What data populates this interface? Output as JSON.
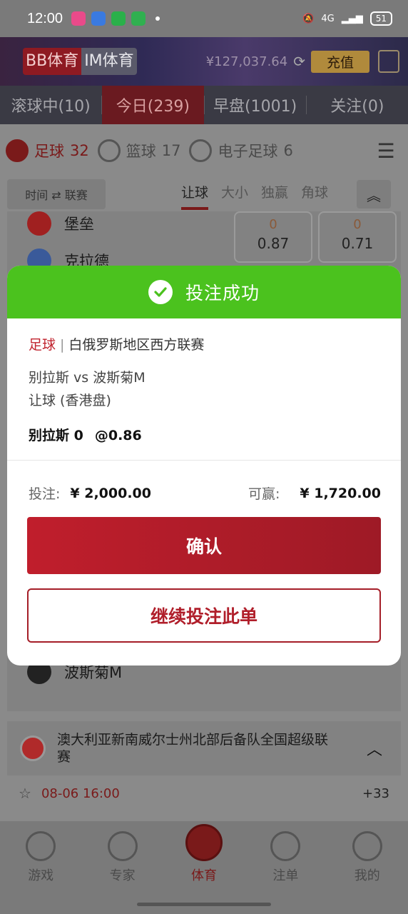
{
  "status_bar": {
    "time": "12:00",
    "battery": "51",
    "network": "4G"
  },
  "header": {
    "brand_bb": "BB体育",
    "brand_im": "IM体育",
    "balance": "¥127,037.64",
    "recharge": "充值"
  },
  "tabs": [
    {
      "label": "滚球中(10)"
    },
    {
      "label": "今日(239)"
    },
    {
      "label": "早盘(1001)"
    },
    {
      "label": "关注(0)"
    }
  ],
  "sports": [
    {
      "name": "足球",
      "count": "32"
    },
    {
      "name": "篮球",
      "count": "17"
    },
    {
      "name": "电子足球",
      "count": "6"
    }
  ],
  "market": {
    "sort_label": "时间 ⇄ 联赛",
    "tabs": [
      "让球",
      "大小",
      "独赢",
      "角球"
    ]
  },
  "match_bg": {
    "team1": "堡垒",
    "team2": "克拉德",
    "team3": "波斯菊M",
    "odds": [
      {
        "line": "0",
        "price": "0.87"
      },
      {
        "line": "0",
        "price": "0.71"
      }
    ]
  },
  "league_row": {
    "name": "澳大利亚新南威尔士州北部后备队全国超级联赛",
    "date": "08-06 16:00",
    "more": "+33"
  },
  "bottom_nav": [
    {
      "label": "游戏"
    },
    {
      "label": "专家"
    },
    {
      "label": "体育"
    },
    {
      "label": "注单"
    },
    {
      "label": "我的"
    }
  ],
  "modal": {
    "title": "投注成功",
    "sport": "足球",
    "league": "白俄罗斯地区西方联赛",
    "match": "别拉斯 vs 波斯菊M",
    "market": "让球 (香港盘)",
    "pick": "别拉斯 0",
    "odds": "@0.86",
    "stake_label": "投注:",
    "stake_value": "¥ 2,000.00",
    "win_label": "可赢:",
    "win_value": "¥ 1,720.00",
    "confirm": "确认",
    "continue": "继续投注此单"
  }
}
